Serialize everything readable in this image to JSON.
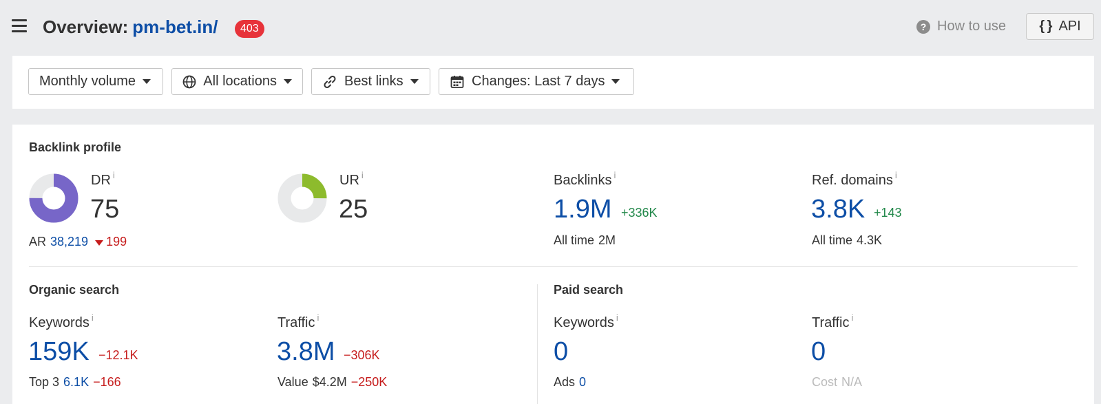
{
  "header": {
    "title_prefix": "Overview:",
    "domain": "pm-bet.in/",
    "status_badge": "403",
    "how_to_use": "How to use",
    "api_label": "API"
  },
  "filters": [
    {
      "label": "Monthly volume",
      "icon": "none"
    },
    {
      "label": "All locations",
      "icon": "globe-icon"
    },
    {
      "label": "Best links",
      "icon": "link-icon"
    },
    {
      "label": "Changes: Last 7 days",
      "icon": "calendar-icon"
    }
  ],
  "backlink_profile": {
    "title": "Backlink profile",
    "dr": {
      "label": "DR",
      "value": "75",
      "gauge": 75,
      "color": "#7766c8"
    },
    "ar": {
      "label": "AR",
      "value": "38,219",
      "change": "199"
    },
    "ur": {
      "label": "UR",
      "value": "25",
      "gauge": 25,
      "color": "#8dbb2d"
    },
    "backlinks": {
      "label": "Backlinks",
      "value": "1.9M",
      "change": "+336K",
      "all_time_label": "All time",
      "all_time_value": "2M"
    },
    "ref_domains": {
      "label": "Ref. domains",
      "value": "3.8K",
      "change": "+143",
      "all_time_label": "All time",
      "all_time_value": "4.3K"
    }
  },
  "organic_search": {
    "title": "Organic search",
    "keywords": {
      "label": "Keywords",
      "value": "159K",
      "change": "−12.1K",
      "top3_label": "Top 3",
      "top3_value": "6.1K",
      "top3_change": "−166"
    },
    "traffic": {
      "label": "Traffic",
      "value": "3.8M",
      "change": "−306K",
      "value_label": "Value",
      "value_amount": "$4.2M",
      "value_change": "−250K"
    }
  },
  "paid_search": {
    "title": "Paid search",
    "keywords": {
      "label": "Keywords",
      "value": "0",
      "ads_label": "Ads",
      "ads_value": "0"
    },
    "traffic": {
      "label": "Traffic",
      "value": "0",
      "cost_label": "Cost",
      "cost_value": "N/A"
    }
  },
  "info_marker": "i"
}
